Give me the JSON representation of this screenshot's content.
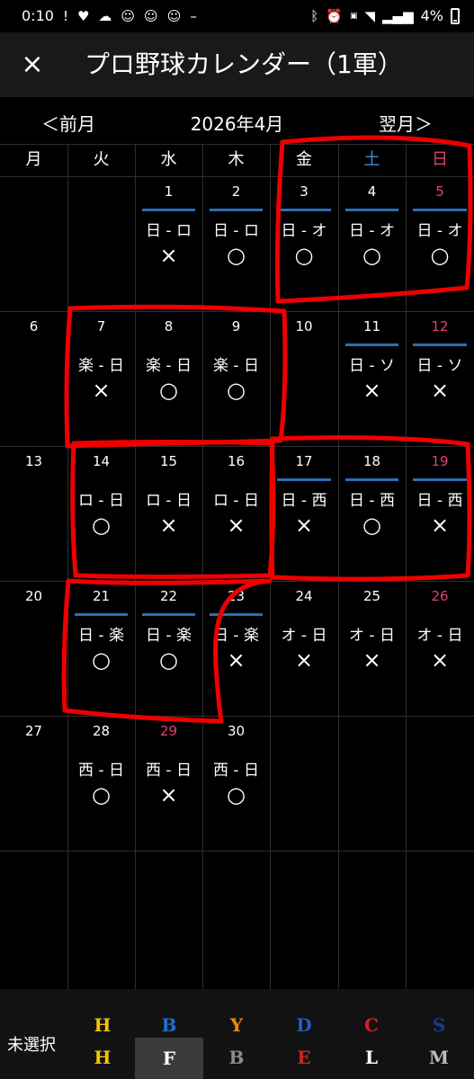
{
  "status": {
    "time": "0:10",
    "battery": "4%",
    "left_icons": [
      "alert-icon",
      "heart-icon",
      "weather-icon",
      "face-icon",
      "face-icon",
      "face-icon",
      "more-icon"
    ],
    "right_icons": [
      "bluetooth-icon",
      "alarm-icon",
      "volte-icon",
      "wifi-icon",
      "signal-icon"
    ]
  },
  "app": {
    "title": "プロ野球カレンダー（1軍）",
    "close_glyph": "×"
  },
  "nav": {
    "prev": "＜前月",
    "month": "2026年4月",
    "next": "翌月＞"
  },
  "weekdays": [
    {
      "label": "月",
      "color": "#ffffff"
    },
    {
      "label": "火",
      "color": "#ffffff"
    },
    {
      "label": "水",
      "color": "#ffffff"
    },
    {
      "label": "木",
      "color": "#ffffff"
    },
    {
      "label": "金",
      "color": "#ffffff"
    },
    {
      "label": "土",
      "color": "#3a8ee6"
    },
    {
      "label": "日",
      "color": "#e0407a"
    }
  ],
  "weeks": [
    [
      {
        "day": ""
      },
      {
        "day": ""
      },
      {
        "day": "1",
        "home": true,
        "match": "日 - ロ",
        "result": "×"
      },
      {
        "day": "2",
        "home": true,
        "match": "日 - ロ",
        "result": "○"
      },
      {
        "day": "3",
        "home": true,
        "match": "日 - オ",
        "result": "○"
      },
      {
        "day": "4",
        "home": true,
        "match": "日 - オ",
        "result": "○"
      },
      {
        "day": "5",
        "red": true,
        "home": true,
        "match": "日 - オ",
        "result": "○"
      }
    ],
    [
      {
        "day": "6"
      },
      {
        "day": "7",
        "match": "楽 - 日",
        "result": "×"
      },
      {
        "day": "8",
        "match": "楽 - 日",
        "result": "○"
      },
      {
        "day": "9",
        "match": "楽 - 日",
        "result": "○"
      },
      {
        "day": "10"
      },
      {
        "day": "11",
        "home": true,
        "match": "日 - ソ",
        "result": "×"
      },
      {
        "day": "12",
        "red": true,
        "home": true,
        "match": "日 - ソ",
        "result": "×"
      }
    ],
    [
      {
        "day": "13"
      },
      {
        "day": "14",
        "match": "ロ - 日",
        "result": "○"
      },
      {
        "day": "15",
        "match": "ロ - 日",
        "result": "×"
      },
      {
        "day": "16",
        "match": "ロ - 日",
        "result": "×"
      },
      {
        "day": "17",
        "home": true,
        "match": "日 - 西",
        "result": "×"
      },
      {
        "day": "18",
        "home": true,
        "match": "日 - 西",
        "result": "○"
      },
      {
        "day": "19",
        "red": true,
        "home": true,
        "match": "日 - 西",
        "result": "×"
      }
    ],
    [
      {
        "day": "20"
      },
      {
        "day": "21",
        "home": true,
        "match": "日 - 楽",
        "result": "○"
      },
      {
        "day": "22",
        "home": true,
        "match": "日 - 楽",
        "result": "○"
      },
      {
        "day": "23",
        "home": true,
        "match": "日 - 楽",
        "result": "×"
      },
      {
        "day": "24",
        "match": "オ - 日",
        "result": "×"
      },
      {
        "day": "25",
        "match": "オ - 日",
        "result": "×"
      },
      {
        "day": "26",
        "red": true,
        "match": "オ - 日",
        "result": "×"
      }
    ],
    [
      {
        "day": "27"
      },
      {
        "day": "28",
        "match": "西 - 日",
        "result": "○"
      },
      {
        "day": "29",
        "red": true,
        "match": "西 - 日",
        "result": "×"
      },
      {
        "day": "30",
        "match": "西 - 日",
        "result": "○"
      },
      {
        "day": ""
      },
      {
        "day": ""
      },
      {
        "day": ""
      }
    ],
    [
      {
        "day": ""
      },
      {
        "day": ""
      },
      {
        "day": ""
      },
      {
        "day": ""
      },
      {
        "day": ""
      },
      {
        "day": ""
      },
      {
        "day": ""
      }
    ]
  ],
  "footer": {
    "unselected": "未選択",
    "teams_top": [
      {
        "icon": "tigers-logo-icon",
        "glyph": "H",
        "color": "#f5c400"
      },
      {
        "icon": "baystars-logo-icon",
        "glyph": "B",
        "color": "#1e6fd0"
      },
      {
        "icon": "giants-logo-icon",
        "glyph": "Y",
        "color": "#f08a00"
      },
      {
        "icon": "dragons-logo-icon",
        "glyph": "D",
        "color": "#1f5fc0"
      },
      {
        "icon": "carp-logo-icon",
        "glyph": "C",
        "color": "#d81e28"
      },
      {
        "icon": "swallows-logo-icon",
        "glyph": "S",
        "color": "#1a3a8c"
      }
    ],
    "teams_bottom": [
      {
        "icon": "hawks-logo-icon",
        "glyph": "H",
        "color": "#f5c400"
      },
      {
        "icon": "fighters-logo-icon",
        "glyph": "F",
        "color": "#ffffff"
      },
      {
        "icon": "buffaloes-logo-icon",
        "glyph": "B",
        "color": "#8c8c8c"
      },
      {
        "icon": "eagles-logo-icon",
        "glyph": "E",
        "color": "#c8281e"
      },
      {
        "icon": "lions-logo-icon",
        "glyph": "L",
        "color": "#ffffff"
      },
      {
        "icon": "marines-logo-icon",
        "glyph": "M",
        "color": "#bbbbbb"
      }
    ],
    "selected_index_bottom": 1
  }
}
